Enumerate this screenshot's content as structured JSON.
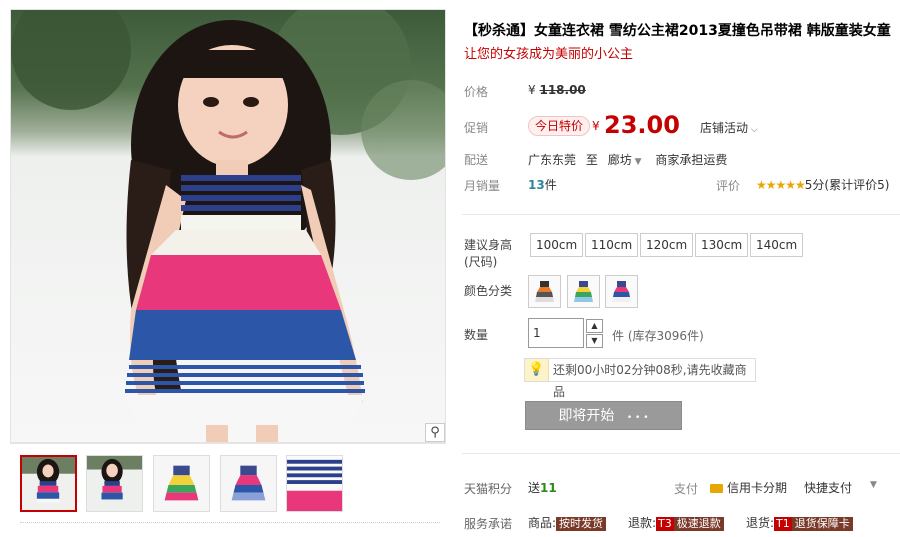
{
  "product": {
    "title": "【秒杀通】女童连衣裙 雪纺公主裙2013夏撞色吊带裙 韩版童装女童",
    "subtitle": "让您的女孩成为美丽的小公主"
  },
  "pricing": {
    "price_label": "价格",
    "original_currency": "¥",
    "original_price": "118.00",
    "promo_label": "促销",
    "promo_badge": "今日特价",
    "promo_currency": "¥",
    "promo_price": "23.00",
    "store_activity": "店铺活动",
    "shipping_label": "配送",
    "ship_from": "广东东莞",
    "ship_to_word": "至",
    "ship_to": "廊坊",
    "shipping_note": "商家承担运费",
    "monthly_sales_label": "月销量",
    "monthly_sales_value": "13",
    "monthly_sales_unit": "件",
    "rating_label": "评价",
    "rating_stars": "★★★★★",
    "rating_text": "5分(累计评价5)"
  },
  "options": {
    "size_label": "建议身高(尺码)",
    "sizes": [
      "100cm",
      "110cm",
      "120cm",
      "130cm",
      "140cm"
    ],
    "color_label": "颜色分类",
    "quantity_label": "数量",
    "quantity_value": "1",
    "quantity_unit": "件",
    "stock_text": "(库存3096件)"
  },
  "tip": {
    "text": "还剩00小时02分钟08秒,请先收藏商品"
  },
  "buy_button": {
    "label": "即将开始",
    "dots": "• • •"
  },
  "tmall_points": {
    "label": "天猫积分",
    "give_word": "送",
    "points": "11"
  },
  "payment": {
    "label": "支付",
    "credit_installment": "信用卡分期",
    "quick_pay": "快捷支付"
  },
  "service": {
    "label": "服务承诺",
    "goods_prefix": "商品:",
    "goods_tag": "按时发货",
    "refund_prefix": "退款:",
    "refund_tag_code": "T3",
    "refund_tag": "极速退款",
    "return_prefix": "退货:",
    "return_tag_code": "T1",
    "return_tag": "退货保障卡"
  },
  "colors": {
    "accent_red": "#c40000",
    "teal": "#31849b",
    "button_gray": "#9a9a9a",
    "star_gold": "#e8a700"
  }
}
